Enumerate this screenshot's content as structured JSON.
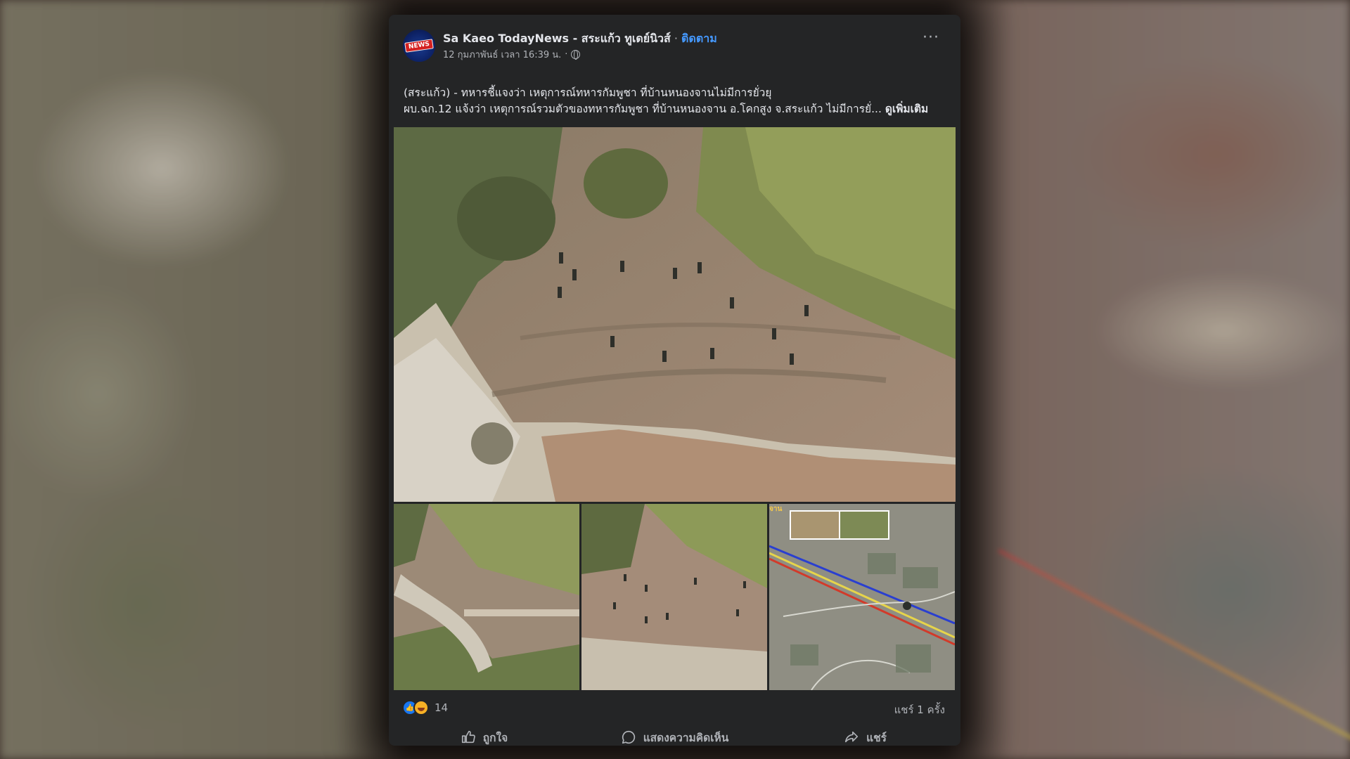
{
  "post": {
    "page_name": "Sa Kaeo TodayNews - สระแก้ว ทูเดย์นิวส์",
    "separator": " · ",
    "follow_label": "ติดตาม",
    "avatar_badge": "NEWS",
    "timestamp": "12 กุมภาพันธ์ เวลา 16:39 น.",
    "meta_separator": "·",
    "privacy_icon": "globe-icon",
    "more_icon": "more-options-icon",
    "text_line1": "(สระแก้ว) - ทหารชี้แจงว่า เหตุการณ์ทหารกัมพูชา ที่บ้านหนองจานไม่มีการยั่วยุ",
    "text_line2": "ผบ.ฉก.12 แจ้งว่า เหตุการณ์รวมตัวของทหารกัมพูชา ที่บ้านหนองจาน อ.โคกสูง จ.สระแก้ว ไม่มีการยั่...",
    "see_more_label": "ดูเพิ่มเติม",
    "map_label": "จาน"
  },
  "footer": {
    "reaction_count": "14",
    "share_count": "แชร์ 1 ครั้ง",
    "like_label": "ถูกใจ",
    "comment_label": "แสดงความคิดเห็น",
    "share_label": "แชร์"
  },
  "colors": {
    "card_bg": "#242526",
    "text_primary": "#e4e6eb",
    "text_secondary": "#b0b3b8",
    "follow_blue": "#4599ff",
    "like_blue": "#1877f2"
  }
}
